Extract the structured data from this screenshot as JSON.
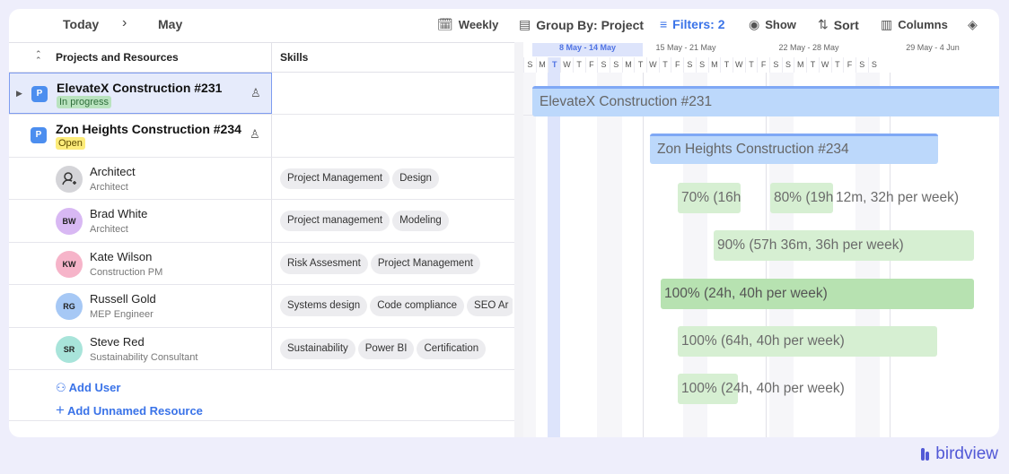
{
  "toolbar": {
    "today": "Today",
    "next_icon": "chevron-right-icon",
    "period": "May",
    "weekly": "Weekly",
    "group_by": "Group By: Project",
    "filters": "Filters: 2",
    "show": "Show",
    "sort": "Sort",
    "columns": "Columns"
  },
  "table": {
    "col_projects": "Projects and Resources",
    "col_skills": "Skills"
  },
  "projects": [
    {
      "badge": "P",
      "title": "ElevateX Construction #231",
      "status": "In progress",
      "status_color": "#b9e3bf"
    },
    {
      "badge": "P",
      "title": "Zon Heights Construction #234",
      "status": "Open",
      "status_color": "#fdec7a"
    }
  ],
  "resources": [
    {
      "initials": "",
      "icon": "user-placeholder-icon",
      "name": "Architect",
      "role": "Architect",
      "avatar_color": "#d4d4d8",
      "skills": [
        "Project Management",
        "Design"
      ]
    },
    {
      "initials": "BW",
      "name": "Brad White",
      "role": "Architect",
      "avatar_color": "#d8b8f3",
      "skills": [
        "Project management",
        "Modeling"
      ]
    },
    {
      "initials": "KW",
      "name": "Kate Wilson",
      "role": "Construction PM",
      "avatar_color": "#f6b4c9",
      "skills": [
        "Risk Assesment",
        "Project Management"
      ]
    },
    {
      "initials": "RG",
      "name": "Russell Gold",
      "role": "MEP Engineer",
      "avatar_color": "#a6c8f5",
      "skills": [
        "Systems design",
        "Code compliance",
        "SEO Ar"
      ]
    },
    {
      "initials": "SR",
      "name": "Steve Red",
      "role": "Sustainability Consultant",
      "avatar_color": "#a8e4da",
      "skills": [
        "Sustainability",
        "Power BI",
        "Certification"
      ]
    }
  ],
  "actions": {
    "add_user": "Add User",
    "add_unnamed": "Add Unnamed Resource"
  },
  "timeline": {
    "weeks": [
      "8 May - 14 May",
      "15 May - 21 May",
      "22 May - 28 May",
      "29 May - 4 Jun"
    ],
    "days": [
      "S",
      "M",
      "T",
      "W",
      "T",
      "F",
      "S",
      "S",
      "M",
      "T",
      "W",
      "T",
      "F",
      "S",
      "S",
      "M",
      "T",
      "W",
      "T",
      "F",
      "S",
      "S",
      "M",
      "T",
      "W",
      "T",
      "F",
      "S",
      "S"
    ],
    "current_day_index": 2
  },
  "bars": {
    "project1": "ElevateX Construction #231",
    "project2": "Zon Heights Construction #234",
    "architect_a": "70% (16h",
    "architect_b": "80% (19h",
    "architect_c": "12m, 32h per week)",
    "brad": "90% (57h 36m, 36h per week)",
    "kate": "100% (24h, 40h per week)",
    "russell": "100% (64h, 40h per week)",
    "steve": "100% (24h, 40h per week)"
  },
  "brand": {
    "name": "birdview",
    "color": "#5158d6"
  }
}
